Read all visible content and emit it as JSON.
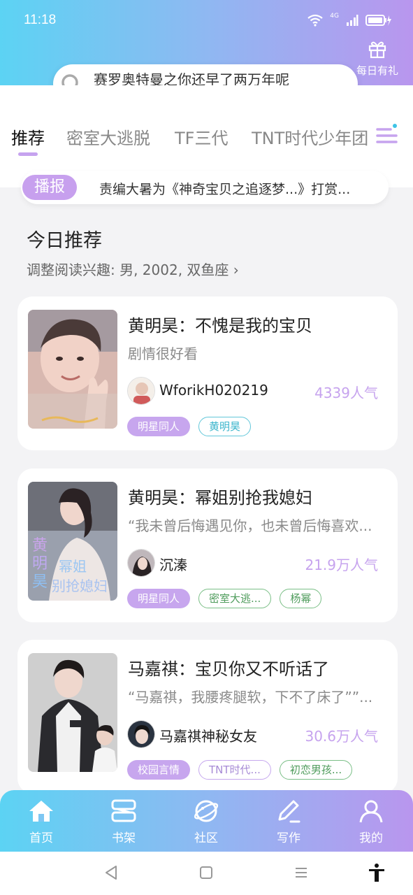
{
  "status_bar": {
    "time": "11:18",
    "network": "4G"
  },
  "gift": {
    "label": "每日有礼",
    "icon": "gift-icon"
  },
  "search": {
    "placeholder": "赛罗奥特曼之你还早了两万年呢",
    "icon": "search-icon"
  },
  "tabs": [
    {
      "label": "推荐",
      "active": true
    },
    {
      "label": "密室大逃脱",
      "active": false
    },
    {
      "label": "TF三代",
      "active": false
    },
    {
      "label": "TNT时代少年团",
      "active": false
    }
  ],
  "broadcast": {
    "badge": "播报",
    "text": "责编大暑为《神奇宝贝之追逐梦...》打赏..."
  },
  "section": {
    "title": "今日推荐",
    "subtitle": "调整阅读兴趣: 男, 2002, 双鱼座 ›"
  },
  "books": [
    {
      "title": "黄明昊：不愧是我的宝贝",
      "desc": "剧情很好看",
      "author": "WforikH020219",
      "popularity": "4339人气",
      "tags": [
        {
          "text": "明星同人",
          "style": "filled"
        },
        {
          "text": "黄明昊",
          "style": "cyan"
        }
      ]
    },
    {
      "title": "黄明昊：幂姐别抢我媳妇",
      "desc": "“我未曾后悔遇见你，也未曾后悔喜欢...",
      "author": "沉溱",
      "popularity": "21.9万人气",
      "tags": [
        {
          "text": "明星同人",
          "style": "filled"
        },
        {
          "text": "密室大逃...",
          "style": "green"
        },
        {
          "text": "杨幂",
          "style": "green"
        }
      ]
    },
    {
      "title": "马嘉祺：宝贝你又不听话了",
      "desc": "“马嘉祺，我腰疼腿软，下不了床了””...",
      "author": "马嘉祺神秘女友",
      "popularity": "30.6万人气",
      "tags": [
        {
          "text": "校园言情",
          "style": "filled"
        },
        {
          "text": "TNT时代...",
          "style": "violet"
        },
        {
          "text": "初恋男孩...",
          "style": "green"
        }
      ]
    }
  ],
  "bottom_nav": [
    {
      "label": "首页",
      "icon": "home-icon"
    },
    {
      "label": "书架",
      "icon": "bookshelf-icon"
    },
    {
      "label": "社区",
      "icon": "planet-icon"
    },
    {
      "label": "写作",
      "icon": "pen-icon"
    },
    {
      "label": "我的",
      "icon": "profile-icon"
    }
  ],
  "colors": {
    "accent": "#c6a3ee",
    "header_start": "#5cd3f3",
    "header_end": "#b996ee"
  }
}
